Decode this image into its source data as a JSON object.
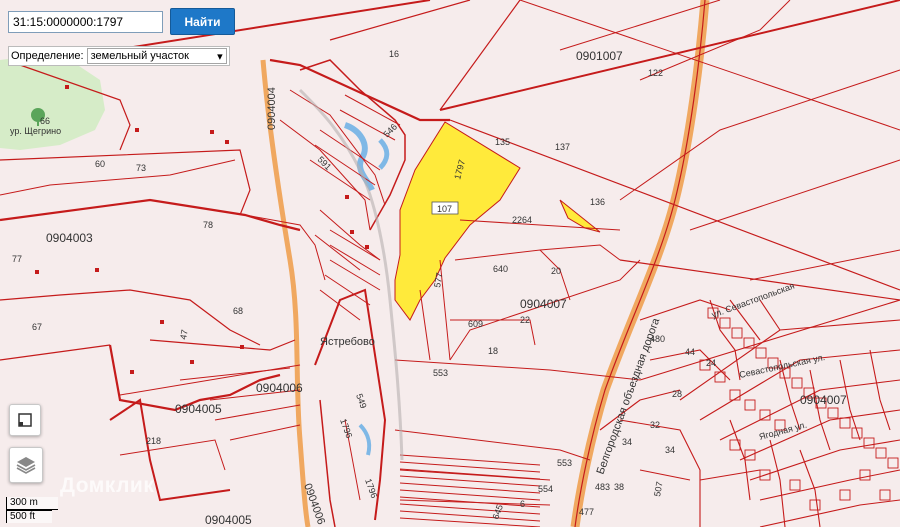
{
  "search": {
    "value": "31:15:0000000:1797",
    "button_label": "Найти"
  },
  "definition": {
    "label": "Определение:",
    "selected": "земельный участок"
  },
  "map_labels": {
    "quarters": [
      "0901007",
      "0904003",
      "0904007",
      "0904006",
      "0904005",
      "0904005",
      "0904007"
    ],
    "parcels": [
      "16",
      "122",
      "135",
      "137",
      "136",
      "1797",
      "107",
      "2264",
      "546",
      "591",
      "640",
      "20",
      "22",
      "609",
      "18",
      "577",
      "553",
      "73",
      "78",
      "60",
      "66",
      "77",
      "67",
      "68",
      "47",
      "218",
      "549",
      "1796",
      "1796",
      "480",
      "44",
      "24",
      "28",
      "32",
      "34",
      "34",
      "553",
      "554",
      "483",
      "38",
      "507",
      "6",
      "645",
      "477"
    ],
    "roads": [
      "Белгородская объездная дорога",
      "ул. Севастопольская",
      "Севастопольская ул.",
      "Ягодная ул."
    ],
    "places": [
      "Ястребово",
      "ур. Щегрино"
    ],
    "vertical": [
      "0904004",
      "0904006"
    ]
  },
  "highlight_color": "#ffea3b",
  "boundary_color": "#c51b1b",
  "road_color": "#f0a860",
  "scale": {
    "metric": "300 m",
    "imperial": "500 ft"
  },
  "watermark": "Домклик",
  "icons": {
    "layers": "layers-icon",
    "frame": "frame-icon",
    "park": "park-icon"
  }
}
